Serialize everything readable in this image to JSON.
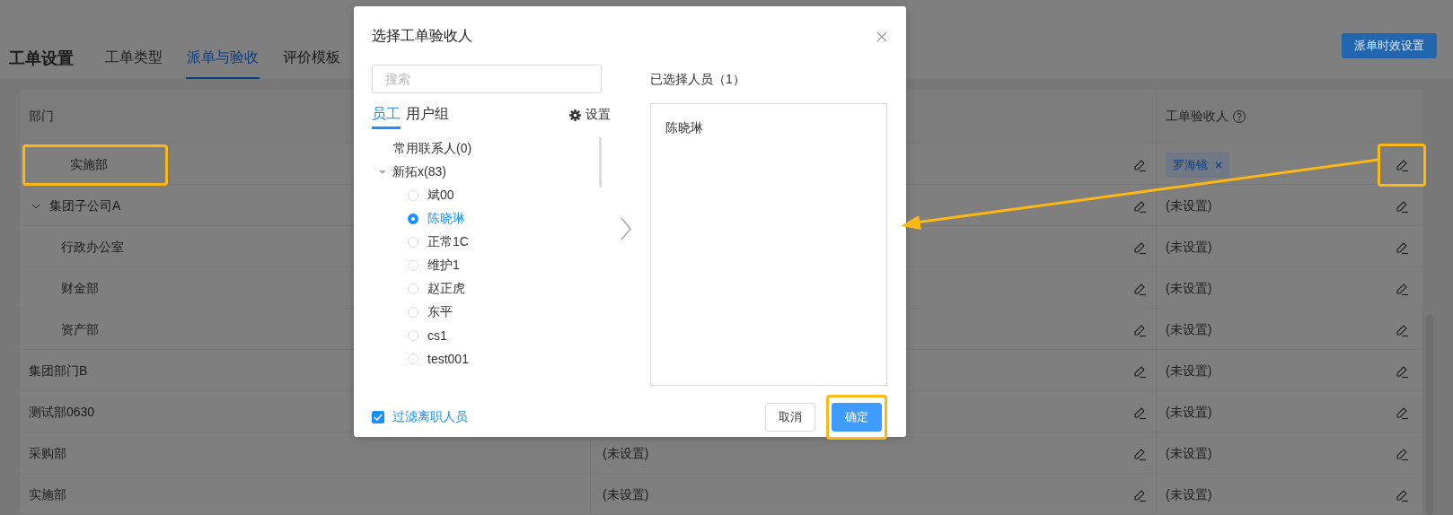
{
  "page": {
    "title": "工单设置",
    "header_button": "派单时效设置"
  },
  "tabs": [
    {
      "label": "工单类型",
      "selected": false
    },
    {
      "label": "派单与验收",
      "selected": true
    },
    {
      "label": "评价模板",
      "selected": false
    }
  ],
  "table": {
    "headers": {
      "department": "部门",
      "acceptor": "工单验收人"
    },
    "rows": [
      {
        "kind": "leaf",
        "department": "实施部",
        "highlighted": true,
        "acceptors": [
          "罗海镜"
        ],
        "edit_highlighted": true
      },
      {
        "kind": "group",
        "department": "集团子公司A",
        "expanded": true,
        "highlighted": false,
        "acceptor_text": "(未设置)",
        "edit_highlighted": false,
        "children": [
          {
            "kind": "plain",
            "department": "行政办公室",
            "highlighted": false,
            "acceptor_text": "(未设置)",
            "edit_highlighted": false
          },
          {
            "kind": "plain",
            "department": "财金部",
            "highlighted": false,
            "acceptor_text": "(未设置)",
            "edit_highlighted": false
          },
          {
            "kind": "plain",
            "department": "资产部",
            "highlighted": false,
            "acceptor_text": "(未设置)",
            "edit_highlighted": false
          }
        ]
      },
      {
        "kind": "plain",
        "department": "集团部门B",
        "highlighted": false,
        "acceptor_text": "(未设置)",
        "edit_highlighted": false
      },
      {
        "kind": "plain",
        "department": "测试部0630",
        "highlighted": false,
        "acceptor_text": "(未设置)",
        "edit_highlighted": false
      },
      {
        "kind": "plain",
        "department": "采购部",
        "highlighted": false,
        "dispatcher_text": "(未设置)",
        "acceptor_text": "(未设置)",
        "edit_highlighted": false
      },
      {
        "kind": "plain",
        "department": "实施部",
        "highlighted": false,
        "dispatcher_text": "(未设置)",
        "acceptor_text": "(未设置)",
        "edit_highlighted": false
      }
    ]
  },
  "dialog": {
    "title": "选择工单验收人",
    "search": {
      "placeholder": "搜索"
    },
    "tabs": [
      {
        "label": "员工",
        "selected": true
      },
      {
        "label": "用户组",
        "selected": false
      }
    ],
    "settings": "设置",
    "tree": [
      {
        "kind": "folder",
        "label": "常用联系人(0)"
      },
      {
        "kind": "group",
        "label": "新拓x(83)",
        "expanded": true,
        "children": [
          {
            "label": "斌00",
            "selected": false
          },
          {
            "label": "陈晓琳",
            "selected": true
          },
          {
            "label": "正常1C",
            "selected": false
          },
          {
            "label": "维护1",
            "selected": false
          },
          {
            "label": "赵正虎",
            "selected": false
          },
          {
            "label": "东平",
            "selected": false
          },
          {
            "label": "cs1",
            "selected": false
          },
          {
            "label": "test001",
            "selected": false
          }
        ]
      }
    ],
    "selected_heading": "已选择人员（1）",
    "selected_people": [
      "陈晓琳"
    ],
    "filter": {
      "label": "过滤离职人员",
      "checked": true
    },
    "buttons": [
      {
        "kind": "default",
        "label": "取消",
        "highlighted": false
      },
      {
        "kind": "primary",
        "label": "确定",
        "highlighted": true
      }
    ]
  }
}
